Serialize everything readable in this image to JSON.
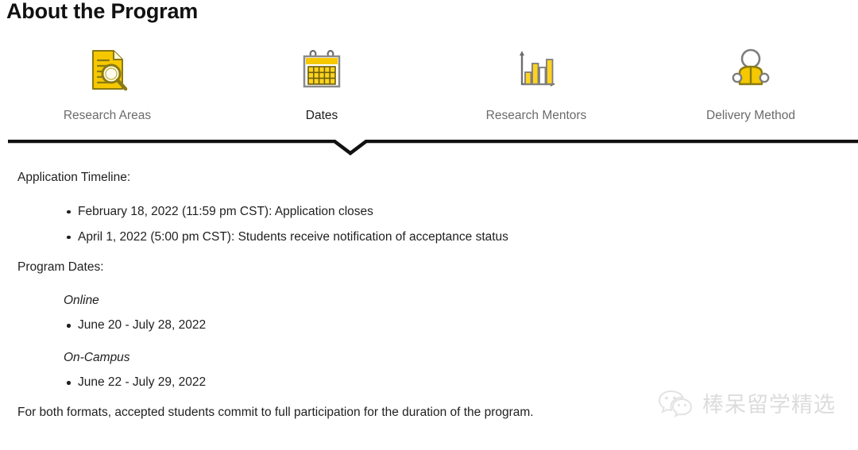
{
  "page_title": "About the Program",
  "accent_color": "#F5C800",
  "active_tab_color": "#1c1c1c",
  "inactive_tab_color": "#6b6b6b",
  "tabs": [
    {
      "label": "Research Areas",
      "icon": "document-magnifier-icon",
      "active": false
    },
    {
      "label": "Dates",
      "icon": "calendar-icon",
      "active": true
    },
    {
      "label": "Research Mentors",
      "icon": "bar-chart-icon",
      "active": false
    },
    {
      "label": "Delivery Method",
      "icon": "person-reading-icon",
      "active": false
    }
  ],
  "content": {
    "application_timeline_heading": "Application Timeline:",
    "application_timeline_items": [
      "February 18, 2022 (11:59 pm CST): Application closes",
      "April 1, 2022 (5:00 pm CST): Students receive notification of acceptance status"
    ],
    "program_dates_heading": "Program Dates:",
    "online_label": "Online",
    "online_dates": "June 20 - July 28, 2022",
    "oncampus_label": "On-Campus",
    "oncampus_dates": "June 22 - July 29, 2022",
    "closing_note": "For both formats, accepted students commit to full participation for the duration of the program."
  },
  "watermark": {
    "icon": "wechat-icon",
    "text": "棒呆留学精选",
    "color": "#dcdcdc"
  }
}
